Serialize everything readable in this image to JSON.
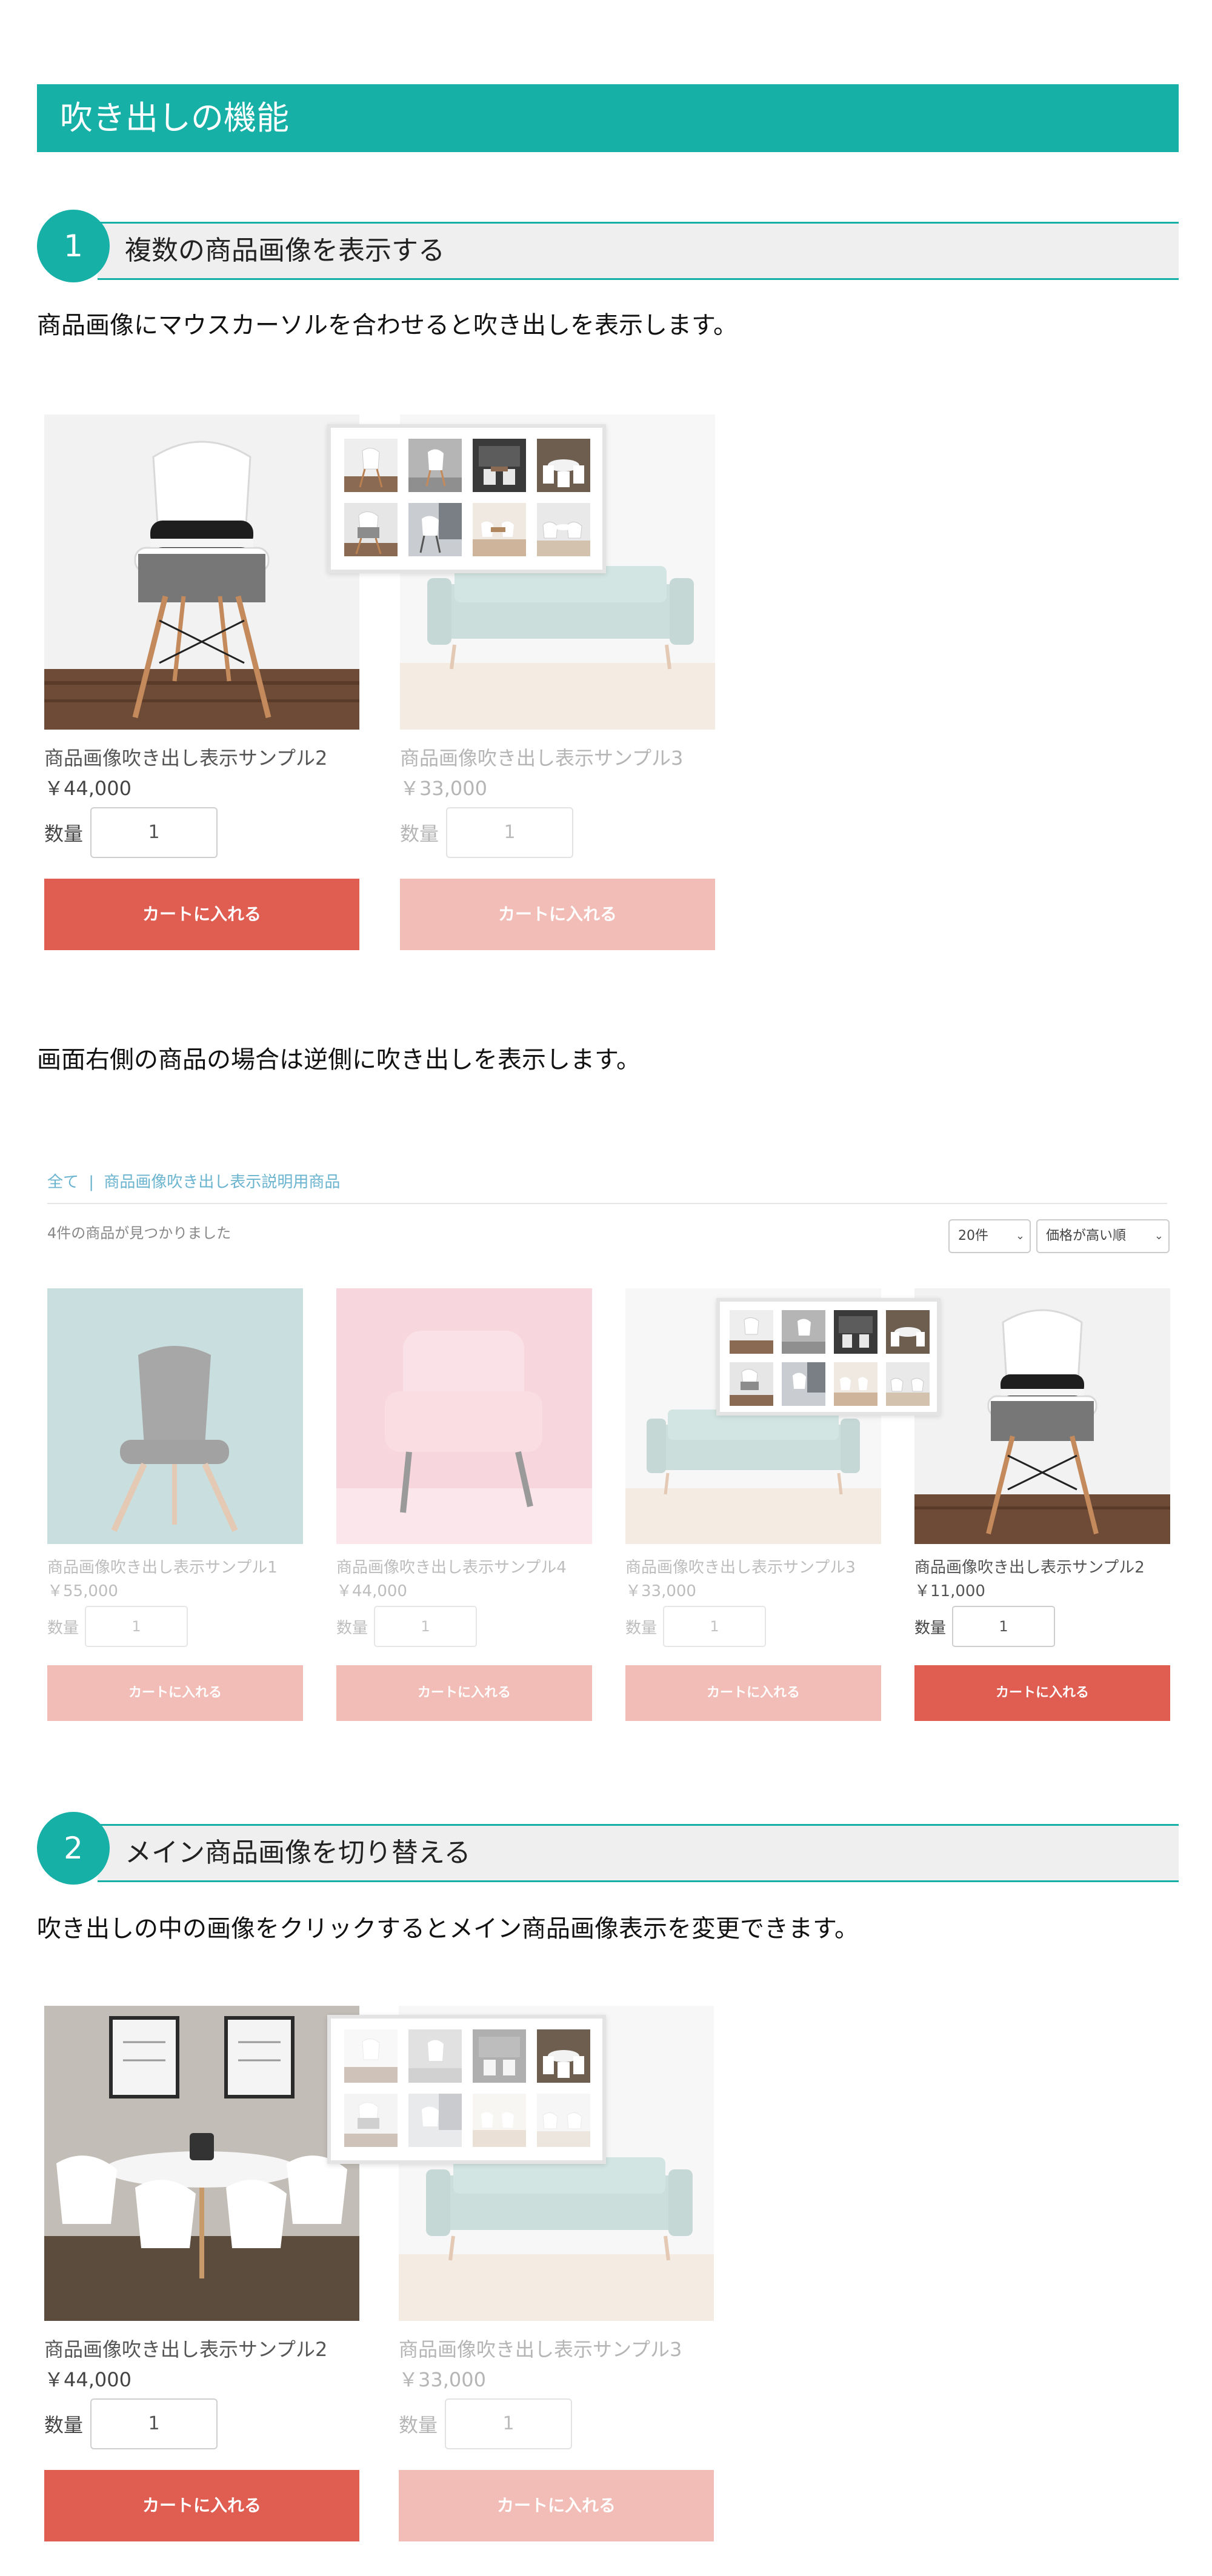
{
  "banner": {
    "title": "吹き出しの機能"
  },
  "section1": {
    "number": "1",
    "title": "複数の商品画像を表示する",
    "desc": "商品画像にマウスカーソルを合わせると吹き出しを表示します。",
    "products": [
      {
        "name": "商品画像吹き出し表示サンプル2",
        "price": "￥44,000",
        "qty_label": "数量",
        "qty": "1",
        "cart": "カートに入れる",
        "image": "white-chair-with-sneakers"
      },
      {
        "name": "商品画像吹き出し表示サンプル3",
        "price": "￥33,000",
        "qty_label": "数量",
        "qty": "1",
        "cart": "カートに入れる",
        "image": "mint-sofa"
      }
    ],
    "desc2": "画面右側の商品の場合は逆側に吹き出しを表示します。"
  },
  "listing": {
    "breadcrumb_all": "全て",
    "breadcrumb_sep": "|",
    "breadcrumb_cat": "商品画像吹き出し表示説明用商品",
    "found": "4件の商品が見つかりました",
    "per_page": "20件",
    "sort": "価格が高い順",
    "products": [
      {
        "name": "商品画像吹き出し表示サンプル1",
        "price": "￥55,000",
        "qty_label": "数量",
        "qty": "1",
        "cart": "カートに入れる",
        "image": "grey-chair"
      },
      {
        "name": "商品画像吹き出し表示サンプル4",
        "price": "￥44,000",
        "qty_label": "数量",
        "qty": "1",
        "cart": "カートに入れる",
        "image": "pink-armchair"
      },
      {
        "name": "商品画像吹き出し表示サンプル3",
        "price": "￥33,000",
        "qty_label": "数量",
        "qty": "1",
        "cart": "カートに入れる",
        "image": "mint-sofa"
      },
      {
        "name": "商品画像吹き出し表示サンプル2",
        "price": "￥11,000",
        "qty_label": "数量",
        "qty": "1",
        "cart": "カートに入れる",
        "image": "white-chair-with-sneakers"
      }
    ]
  },
  "section2": {
    "number": "2",
    "title": "メイン商品画像を切り替える",
    "desc": "吹き出しの中の画像をクリックするとメイン商品画像表示を変更できます。",
    "products": [
      {
        "name": "商品画像吹き出し表示サンプル2",
        "price": "￥44,000",
        "qty_label": "数量",
        "qty": "1",
        "cart": "カートに入れる",
        "image": "dining-table-set"
      },
      {
        "name": "商品画像吹き出し表示サンプル3",
        "price": "￥33,000",
        "qty_label": "数量",
        "qty": "1",
        "cart": "カートに入れる",
        "image": "mint-sofa"
      }
    ]
  },
  "popup_thumbs": [
    "chair-side",
    "chair-grey",
    "dining-dark",
    "dining-table",
    "chair-blanket",
    "chair-window",
    "chairs-warm",
    "chairs-white"
  ],
  "colors": {
    "accent": "#16b0a7",
    "cart": "#e05d52",
    "cart_faded": "#f2bdb6",
    "link": "#6ab4cf"
  }
}
